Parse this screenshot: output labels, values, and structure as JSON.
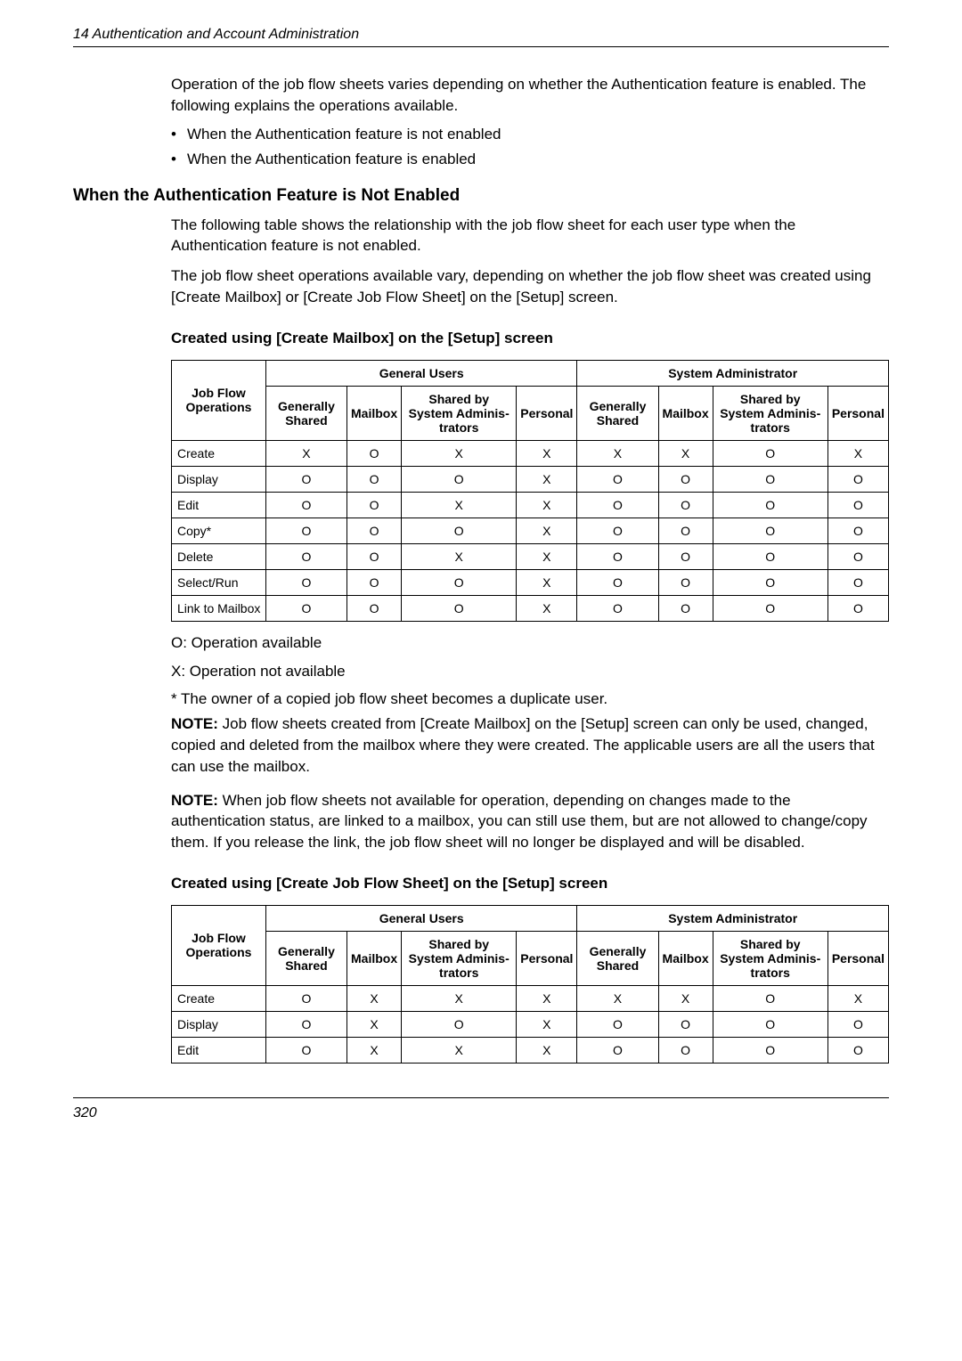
{
  "header": "14  Authentication and Account Administration",
  "intro": {
    "p1": "Operation of the job flow sheets varies depending on whether the Authentication feature is enabled. The following explains the operations available.",
    "bullets": [
      "When the Authentication feature is not enabled",
      "When the Authentication feature is enabled"
    ]
  },
  "section1": {
    "title": "When the Authentication Feature is Not Enabled",
    "p1": "The following table shows the relationship with the job flow sheet for each user type when the Authentication feature is not enabled.",
    "p2": "The job flow sheet operations available vary, depending on whether the job flow sheet was created using [Create Mailbox] or [Create Job Flow Sheet] on the [Setup] screen.",
    "sub1": "Created using [Create Mailbox] on the [Setup] screen",
    "table1": {
      "colgroups": [
        "General Users",
        "System Administrator"
      ],
      "rowheader": "Job Flow Operations",
      "cols": [
        "Generally Shared",
        "Mailbox",
        "Shared by System Adminis-trators",
        "Personal",
        "Generally Shared",
        "Mailbox",
        "Shared by System Adminis-trators",
        "Personal"
      ],
      "rows": [
        {
          "label": "Create",
          "v": [
            "X",
            "O",
            "X",
            "X",
            "X",
            "X",
            "O",
            "X"
          ]
        },
        {
          "label": "Display",
          "v": [
            "O",
            "O",
            "O",
            "X",
            "O",
            "O",
            "O",
            "O"
          ]
        },
        {
          "label": "Edit",
          "v": [
            "O",
            "O",
            "X",
            "X",
            "O",
            "O",
            "O",
            "O"
          ]
        },
        {
          "label": "Copy*",
          "v": [
            "O",
            "O",
            "O",
            "X",
            "O",
            "O",
            "O",
            "O"
          ]
        },
        {
          "label": "Delete",
          "v": [
            "O",
            "O",
            "X",
            "X",
            "O",
            "O",
            "O",
            "O"
          ]
        },
        {
          "label": "Select/Run",
          "v": [
            "O",
            "O",
            "O",
            "X",
            "O",
            "O",
            "O",
            "O"
          ]
        },
        {
          "label": "Link to Mailbox",
          "v": [
            "O",
            "O",
            "O",
            "X",
            "O",
            "O",
            "O",
            "O"
          ]
        }
      ]
    },
    "legend1": "O: Operation available",
    "legend2": "X: Operation not available",
    "legend3": "*  The owner of a copied job flow sheet becomes a duplicate user.",
    "note1_label": "NOTE:",
    "note1": " Job flow sheets created from [Create Mailbox] on the [Setup] screen can only be used, changed, copied and deleted from the mailbox where they were created. The applicable users are all the users that can use the mailbox.",
    "note2_label": "NOTE:",
    "note2": " When job flow sheets not available for operation, depending on changes made to the authentication status, are linked to a mailbox, you can still use them, but are not allowed to change/copy them. If you release the link, the job flow sheet will no longer be displayed and will be disabled.",
    "sub2": "Created using [Create Job Flow Sheet] on the [Setup] screen",
    "table2": {
      "colgroups": [
        "General Users",
        "System Administrator"
      ],
      "rowheader": "Job Flow Operations",
      "cols": [
        "Generally Shared",
        "Mailbox",
        "Shared by System Adminis-trators",
        "Personal",
        "Generally Shared",
        "Mailbox",
        "Shared by System Adminis-trators",
        "Personal"
      ],
      "rows": [
        {
          "label": "Create",
          "v": [
            "O",
            "X",
            "X",
            "X",
            "X",
            "X",
            "O",
            "X"
          ]
        },
        {
          "label": "Display",
          "v": [
            "O",
            "X",
            "O",
            "X",
            "O",
            "O",
            "O",
            "O"
          ]
        },
        {
          "label": "Edit",
          "v": [
            "O",
            "X",
            "X",
            "X",
            "O",
            "O",
            "O",
            "O"
          ]
        }
      ]
    }
  },
  "page_number": "320"
}
